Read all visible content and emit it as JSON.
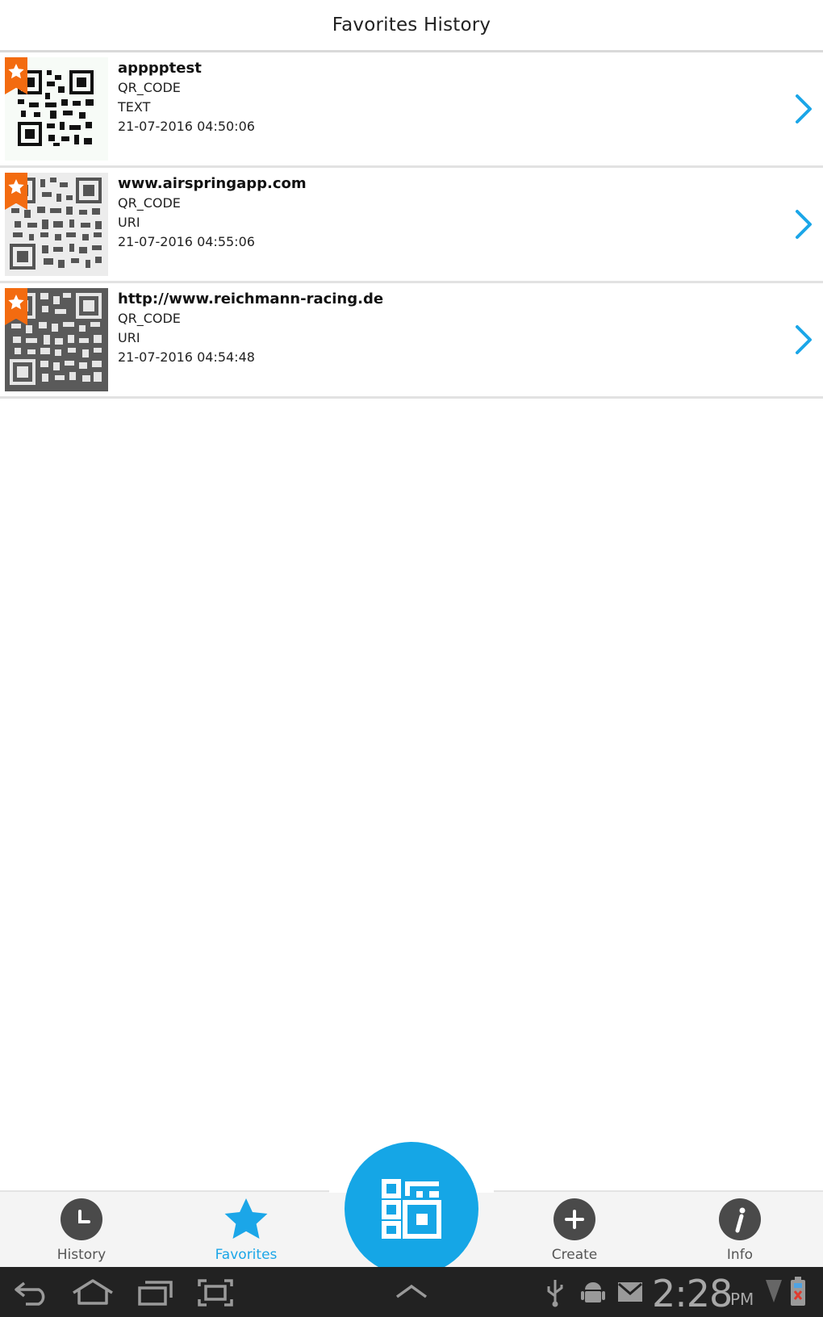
{
  "header": {
    "title": "Favorites History"
  },
  "items": [
    {
      "name": "apppptest",
      "format": "QR_CODE",
      "type": "TEXT",
      "date": "21-07-2016 04:50:06"
    },
    {
      "name": "www.airspringapp.com",
      "format": "QR_CODE",
      "type": "URI",
      "date": "21-07-2016 04:55:06"
    },
    {
      "name": "http://www.reichmann-racing.de",
      "format": "QR_CODE",
      "type": "URI",
      "date": "21-07-2016 04:54:48"
    }
  ],
  "tabs": {
    "history": "History",
    "favorites": "Favorites",
    "create": "Create",
    "info": "Info"
  },
  "system": {
    "time": "2:28",
    "ampm": "PM"
  },
  "colors": {
    "accent": "#15a6e6",
    "badge": "#f36b10",
    "sysbar": "#222222"
  },
  "icons": [
    "star-icon",
    "chevron-right-icon",
    "clock-icon",
    "plus-icon",
    "info-icon",
    "qr-scan-icon",
    "back-icon",
    "home-icon",
    "recents-icon",
    "screenshot-icon",
    "usb-icon",
    "android-icon",
    "mail-icon",
    "signal-icon",
    "battery-icon"
  ]
}
